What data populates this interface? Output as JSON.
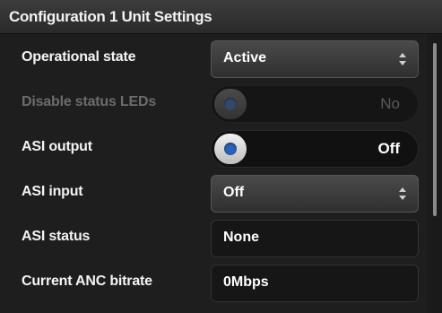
{
  "header": {
    "title": "Configuration 1 Unit Settings"
  },
  "rows": {
    "operational_state": {
      "label": "Operational state",
      "value": "Active"
    },
    "disable_status_leds": {
      "label": "Disable status LEDs",
      "value": "No",
      "enabled": false
    },
    "asi_output": {
      "label": "ASI output",
      "value": "Off"
    },
    "asi_input": {
      "label": "ASI input",
      "value": "Off"
    },
    "asi_status": {
      "label": "ASI status",
      "value": "None"
    },
    "current_anc_bitrate": {
      "label": "Current ANC bitrate",
      "value": "0Mbps"
    }
  },
  "icons": {
    "select_arrows": "up-down-chevron-icon",
    "toggle_knob": "toggle-knob-icon"
  },
  "colors": {
    "accent": "#2b62b5",
    "background": "#1e1e1e"
  }
}
